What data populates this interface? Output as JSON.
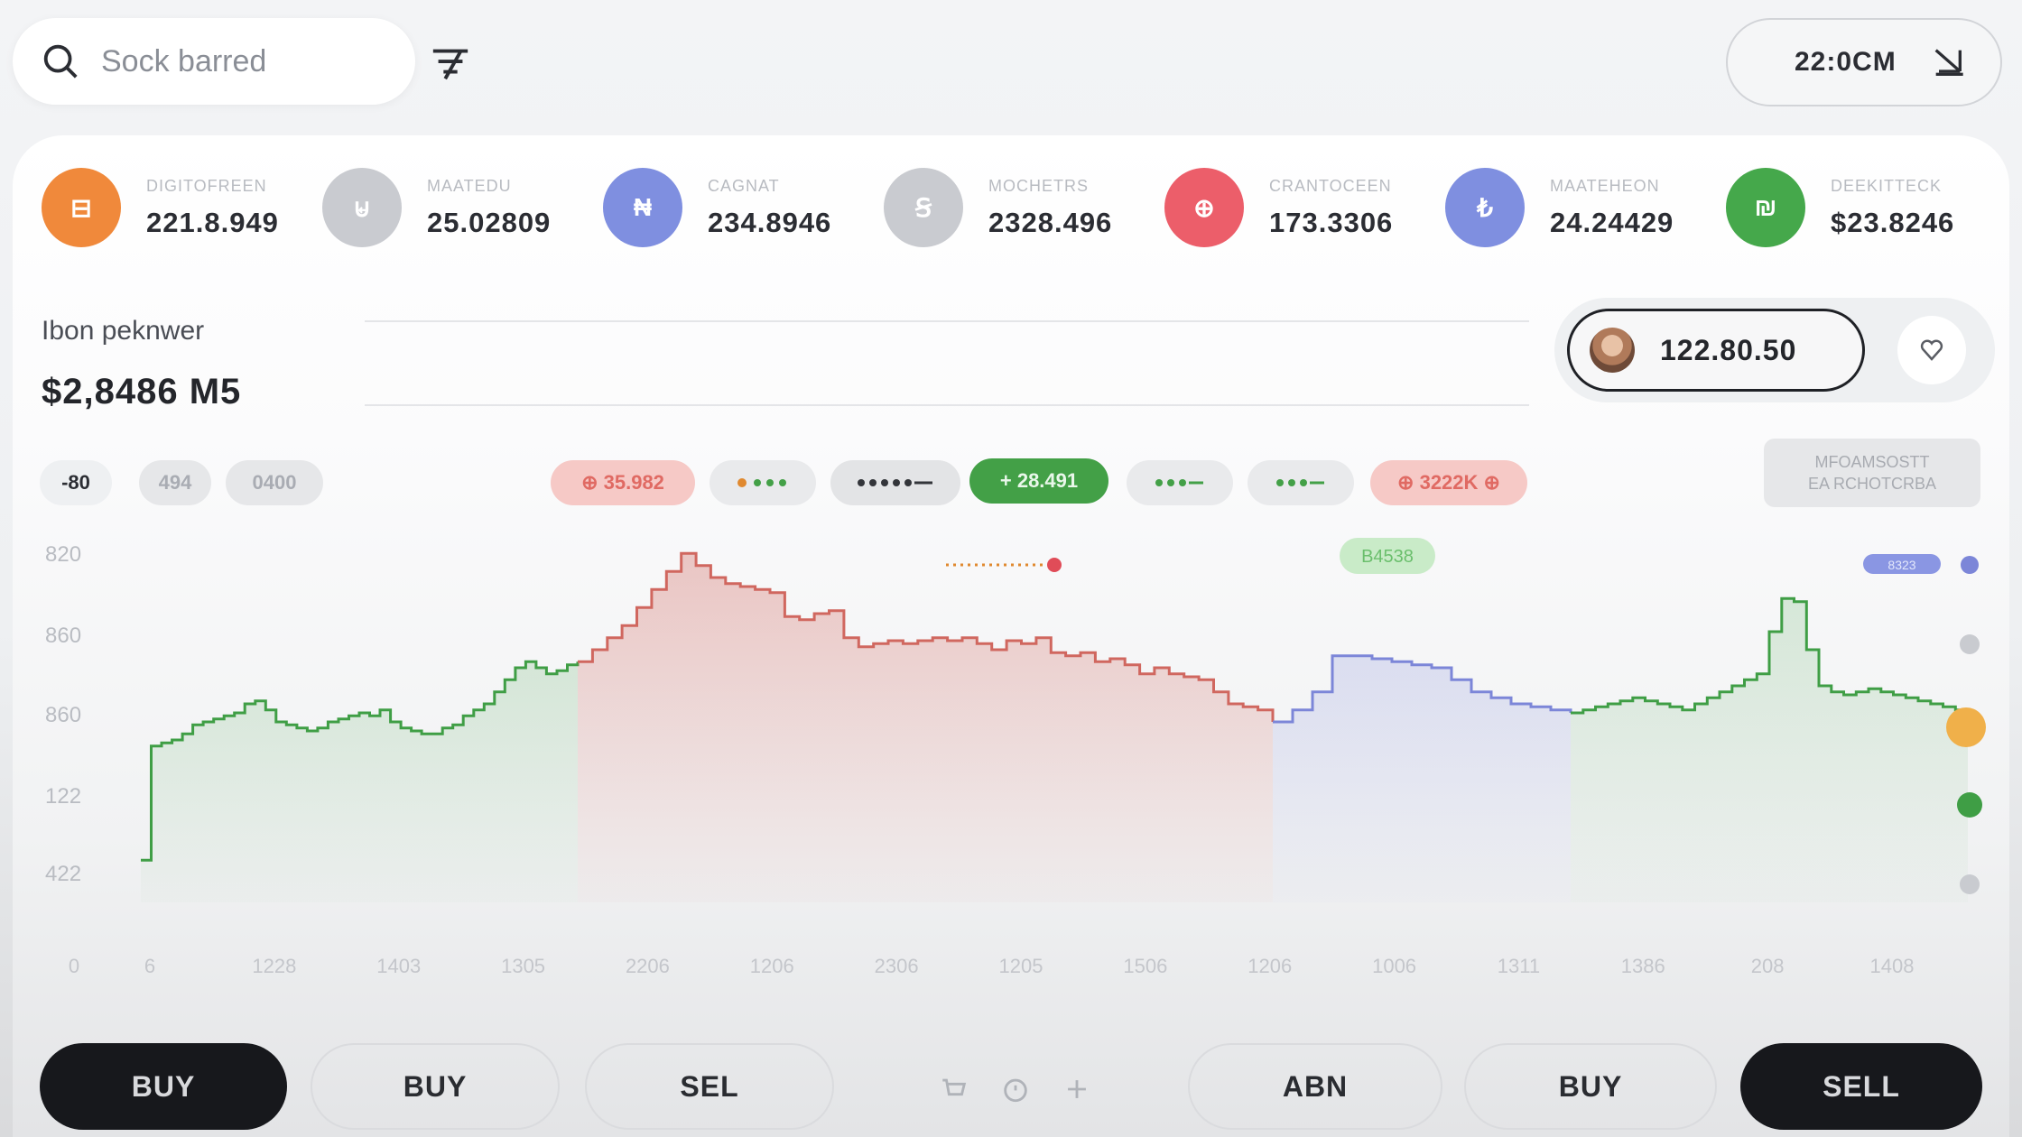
{
  "search": {
    "placeholder": "Sock barred"
  },
  "header": {
    "time_label": "22:0CM"
  },
  "tickers": [
    {
      "glyph": "⊟",
      "name": "DIGITOFREEN",
      "value": "221.8.949",
      "color": "#f0893b"
    },
    {
      "glyph": "⊌",
      "name": "MAATEDU",
      "value": "25.02809",
      "color": "#c9cbd0"
    },
    {
      "glyph": "₦",
      "name": "CAGNAT",
      "value": "234.8946",
      "color": "#7f8fe0"
    },
    {
      "glyph": "Ꞩ",
      "name": "MOCHETRS",
      "value": "2328.496",
      "color": "#c9cbd0"
    },
    {
      "glyph": "⊕",
      "name": "CRANTOCEEN",
      "value": "173.3306",
      "color": "#ec5e6a"
    },
    {
      "glyph": "₺",
      "name": "MAATEHEON",
      "value": "24.24429",
      "color": "#7f8fe0"
    },
    {
      "glyph": "₪",
      "name": "DEEKITTECK",
      "value": "$23.8246",
      "color": "#45a84b"
    }
  ],
  "balance": {
    "label": "Ibon peknwer",
    "value": "$2,8486 M5"
  },
  "wallet": {
    "value": "122.80.50"
  },
  "chips": {
    "left": [
      "-80",
      "494",
      "0400"
    ],
    "red1": "⊕ 35.982",
    "green": "+ 28.491",
    "red2": "⊕ 3222K ⊕"
  },
  "info_box": {
    "line1": "MFOAMSOSTT",
    "line2": "EA RCHOTCRBA"
  },
  "markers": {
    "green_label": "B4538",
    "purple_label": "8323"
  },
  "bottom_buttons": [
    "BUY",
    "BUY",
    "SEL",
    "ABN",
    "BUY",
    "SELL"
  ],
  "chart_data": {
    "type": "line",
    "y_ticks": [
      "820",
      "860",
      "860",
      "122",
      "422"
    ],
    "x_ticks": [
      "0",
      "6",
      "1228",
      "1403",
      "1305",
      "2206",
      "1206",
      "2306",
      "1205",
      "1506",
      "1206",
      "1006",
      "1311",
      "1386",
      "208",
      "1408"
    ],
    "series": [
      {
        "color": "#3f9e45",
        "values": [
          140,
          520,
          530,
          540,
          560,
          590,
          600,
          610,
          620,
          630,
          660,
          670,
          640,
          600,
          590,
          580,
          570,
          580,
          600,
          610,
          620,
          630,
          620,
          640,
          600,
          580,
          570,
          560,
          560,
          580,
          590,
          620,
          640,
          660,
          700,
          740,
          780,
          800,
          780,
          760,
          770,
          790,
          800
        ]
      },
      {
        "color": "#d0675f",
        "values": [
          800,
          840,
          880,
          920,
          980,
          1040,
          1100,
          1160,
          1120,
          1080,
          1060,
          1050,
          1040,
          1030,
          950,
          940,
          960,
          970,
          880,
          850,
          860,
          870,
          860,
          870,
          880,
          870,
          880,
          860,
          840,
          870,
          860,
          880,
          830,
          820,
          830,
          800,
          810,
          790,
          760,
          780,
          760,
          750,
          740,
          700,
          660,
          650,
          640,
          600
        ]
      },
      {
        "color": "#7c86d8",
        "values": [
          600,
          640,
          700,
          820,
          820,
          810,
          800,
          790,
          780,
          740,
          700,
          680,
          660,
          650,
          640,
          630
        ]
      },
      {
        "color": "#3f9e45",
        "values": [
          630,
          640,
          650,
          660,
          670,
          680,
          670,
          660,
          650,
          640,
          660,
          680,
          700,
          720,
          740,
          760,
          900,
          1010,
          1000,
          840,
          720,
          700,
          690,
          700,
          710,
          700,
          690,
          680,
          670,
          660,
          650,
          640,
          640
        ]
      }
    ]
  }
}
